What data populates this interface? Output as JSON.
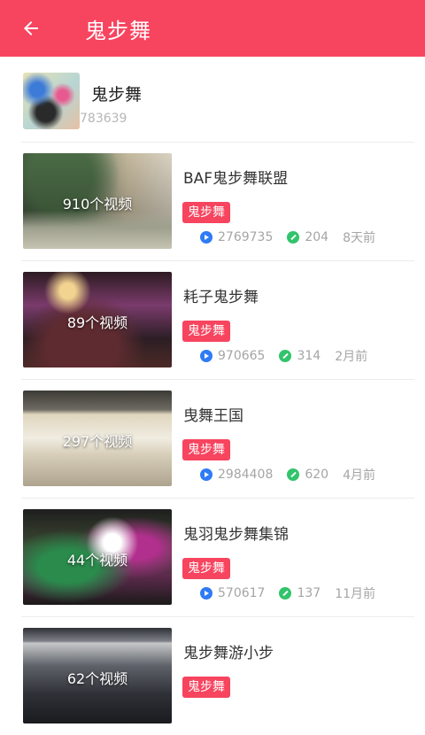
{
  "appbar": {
    "title": "鬼步舞",
    "back_icon": "arrow-left-icon"
  },
  "header": {
    "name": "鬼步舞",
    "count": "783639"
  },
  "items": [
    {
      "title": "BAF鬼步舞联盟",
      "video_count": "910个视频",
      "tag": "鬼步舞",
      "plays": "2769735",
      "comments": "204",
      "time": "8天前"
    },
    {
      "title": "耗子鬼步舞",
      "video_count": "89个视频",
      "tag": "鬼步舞",
      "plays": "970665",
      "comments": "314",
      "time": "2月前"
    },
    {
      "title": "曳舞王国",
      "video_count": "297个视频",
      "tag": "鬼步舞",
      "plays": "2984408",
      "comments": "620",
      "time": "4月前"
    },
    {
      "title": "鬼羽鬼步舞集锦",
      "video_count": "44个视频",
      "tag": "鬼步舞",
      "plays": "570617",
      "comments": "137",
      "time": "11月前"
    },
    {
      "title": "鬼步舞游小步",
      "video_count": "62个视频",
      "tag": "鬼步舞",
      "plays": "",
      "comments": "",
      "time": ""
    }
  ],
  "colors": {
    "accent": "#f7445f",
    "play_icon": "#2f7bf5",
    "comment_icon": "#31c46b"
  }
}
